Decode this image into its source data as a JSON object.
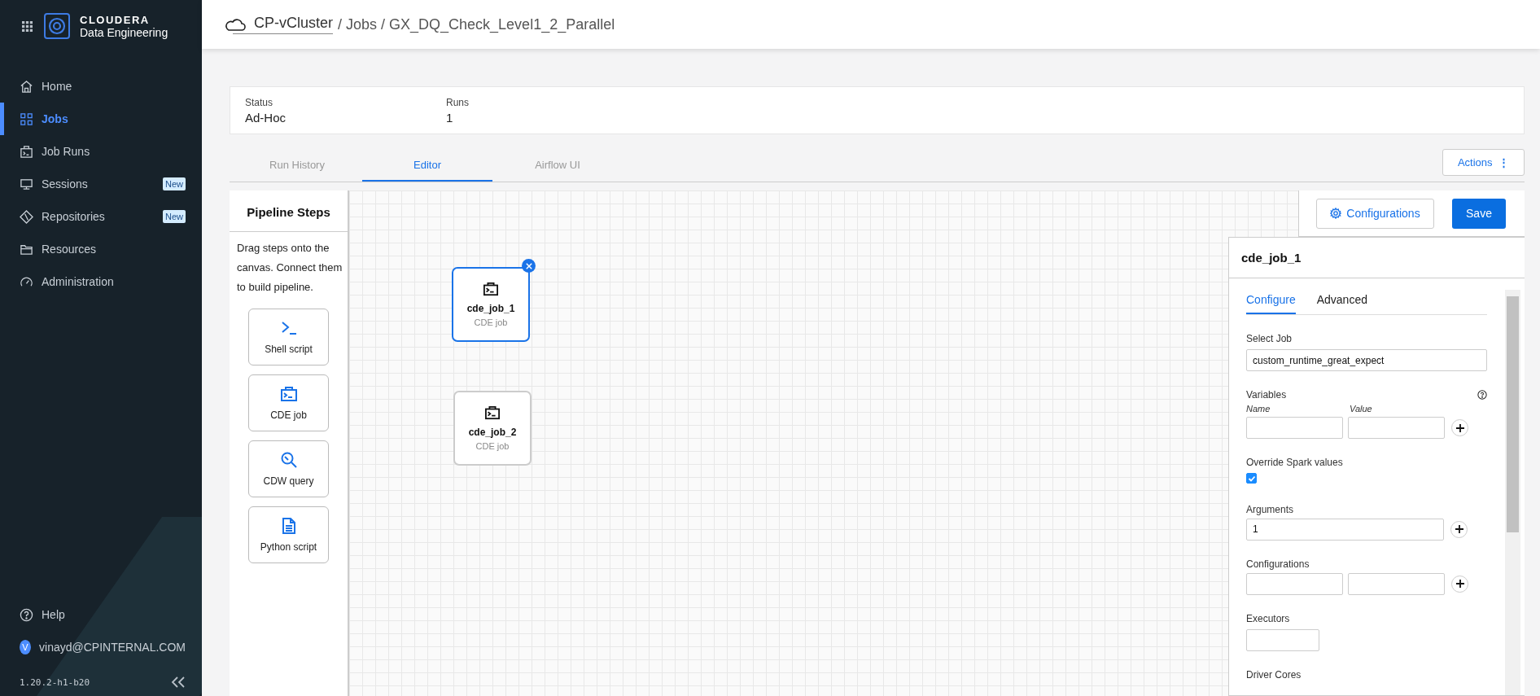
{
  "sidebar": {
    "brand": {
      "name": "CLOUDERA",
      "product": "Data Engineering"
    },
    "items": [
      {
        "label": "Home",
        "selected": false
      },
      {
        "label": "Jobs",
        "selected": true
      },
      {
        "label": "Job Runs",
        "selected": false
      },
      {
        "label": "Sessions",
        "selected": false,
        "badge": "New"
      },
      {
        "label": "Repositories",
        "selected": false,
        "badge": "New"
      },
      {
        "label": "Resources",
        "selected": false
      },
      {
        "label": "Administration",
        "selected": false
      }
    ],
    "help": "Help",
    "user": {
      "initial": "V",
      "email": "vinayd@CPINTERNAL.COM"
    },
    "version": "1.20.2-h1-b20"
  },
  "breadcrumb": {
    "cluster": "CP-vCluster",
    "rest": "/ Jobs / GX_DQ_Check_Level1_2_Parallel"
  },
  "summary": [
    {
      "label": "Status",
      "value": "Ad-Hoc"
    },
    {
      "label": "Runs",
      "value": "1"
    }
  ],
  "tabs": [
    {
      "label": "Run History",
      "selected": false
    },
    {
      "label": "Editor",
      "selected": true
    },
    {
      "label": "Airflow UI",
      "selected": false
    }
  ],
  "actions": "Actions",
  "actions_icon": "⋮",
  "pipeline_steps": {
    "title": "Pipeline Steps",
    "hint": "Drag steps onto the canvas. Connect them to build pipeline.",
    "items": [
      "Shell script",
      "CDE job",
      "CDW query",
      "Python script"
    ]
  },
  "canvas": {
    "nodes": [
      {
        "name": "cde_job_1",
        "type": "CDE job",
        "selected": true
      },
      {
        "name": "cde_job_2",
        "type": "CDE job",
        "selected": false
      }
    ]
  },
  "toolbar": {
    "configurations": "Configurations",
    "save": "Save"
  },
  "details": {
    "title": "cde_job_1",
    "tabs": [
      {
        "label": "Configure",
        "selected": true
      },
      {
        "label": "Advanced",
        "selected": false
      }
    ],
    "fields": [
      {
        "kind": "text",
        "label": "Select Job",
        "value": "custom_runtime_great_expect"
      },
      {
        "kind": "pairs",
        "label": "Variables",
        "help": true,
        "columns": [
          "Name",
          "Value"
        ]
      },
      {
        "kind": "checkbox",
        "label": "Override Spark values",
        "checked": true
      },
      {
        "kind": "list",
        "label": "Arguments",
        "value": "1"
      },
      {
        "kind": "pairs",
        "label": "Configurations"
      },
      {
        "kind": "short",
        "label": "Executors"
      },
      {
        "kind": "label",
        "label": "Driver Cores"
      }
    ]
  }
}
